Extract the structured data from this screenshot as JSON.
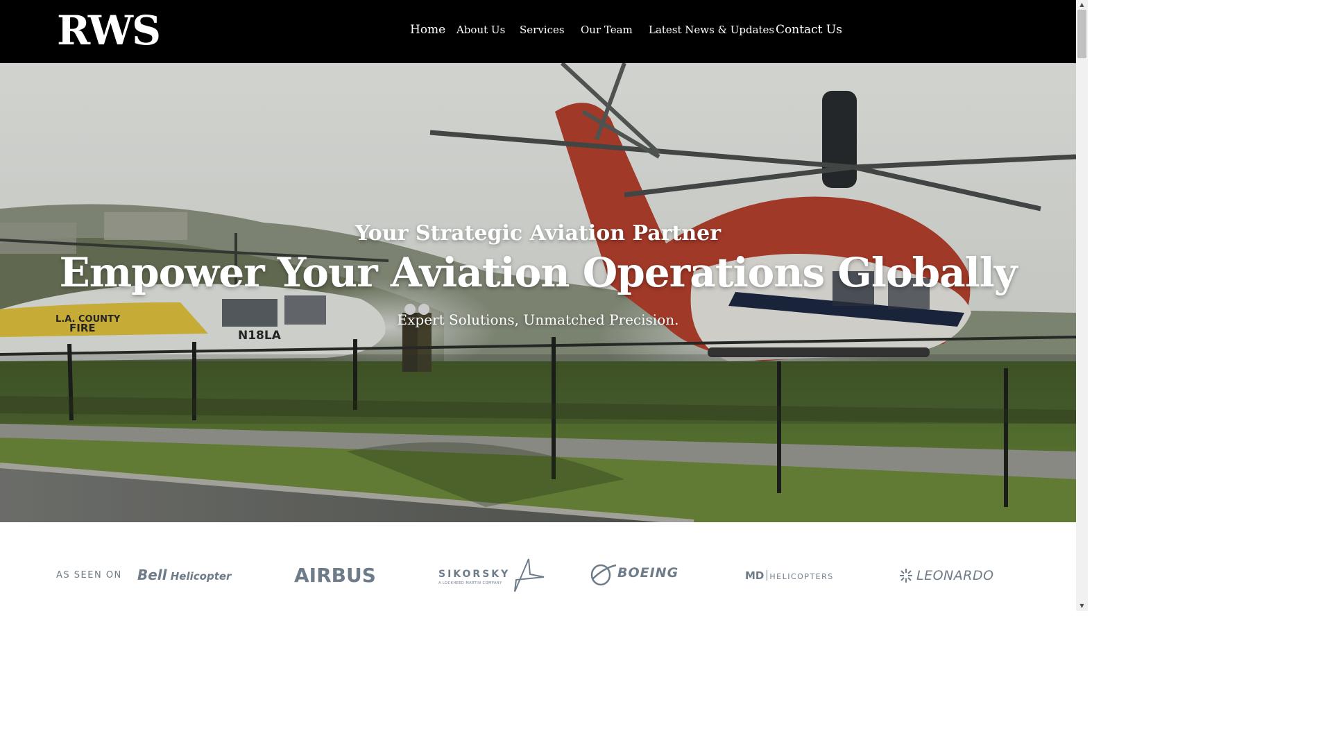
{
  "header": {
    "logo": "RWS",
    "nav": {
      "home": "Home",
      "about": "About Us",
      "services": "Services",
      "team": "Our Team",
      "news": "Latest News & Updates",
      "contact": "Contact Us"
    }
  },
  "hero": {
    "eyebrow": "Your Strategic Aviation Partner",
    "title": "Empower Your Aviation Operations Globally",
    "subtitle": "Expert Solutions, Unmatched Precision.",
    "image_text": {
      "la_county": "L.A. COUNTY",
      "fire": "FIRE",
      "tail_number": "N18LA"
    }
  },
  "as_seen_on": {
    "label": "AS SEEN ON",
    "logos": {
      "bell_a": "Bell",
      "bell_b": " Helicopter",
      "airbus": "AIRBUS",
      "sikorsky": "SIKORSKY",
      "sikorsky_tag": "A LOCKHEED MARTIN COMPANY",
      "boeing": "BOEING",
      "md": "MD",
      "md_helicopters": "HELICOPTERS",
      "leonardo": "LEONARDO"
    }
  },
  "colors": {
    "header_bg": "#000000",
    "logo_gray": "#6e7c8a",
    "sky": "#e9ebe6",
    "grass": "#5f7f34",
    "helicopter_red": "#b8412e"
  },
  "scrollbar": {
    "up": "▲",
    "down": "▼"
  }
}
